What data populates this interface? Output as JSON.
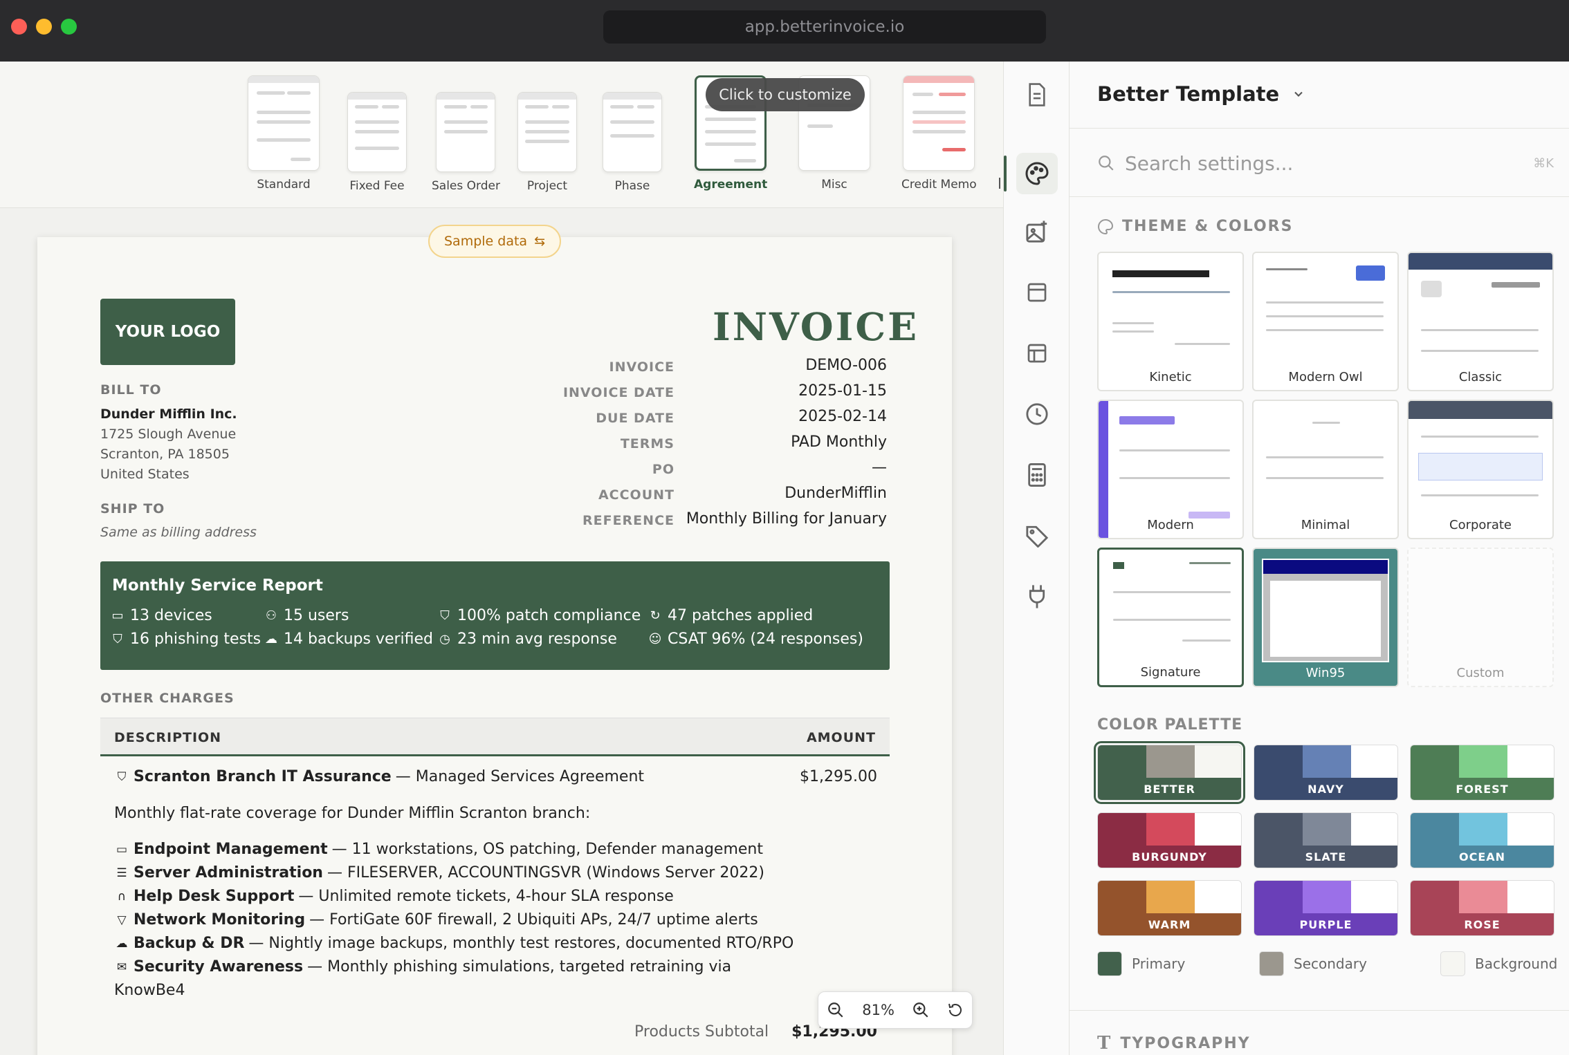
{
  "browser": {
    "url": "app.betterinvoice.io"
  },
  "templates": {
    "tooltip": "Click to customize",
    "items": [
      {
        "label": "Standard"
      },
      {
        "label": "Fixed Fee"
      },
      {
        "label": "Sales Order"
      },
      {
        "label": "Project"
      },
      {
        "label": "Phase"
      },
      {
        "label": "Agreement",
        "selected": true
      },
      {
        "label": "Misc"
      },
      {
        "label": "Credit Memo"
      }
    ]
  },
  "invoice": {
    "sample_data_label": "Sample data",
    "logo_text": "YOUR LOGO",
    "title": "INVOICE",
    "bill_to": {
      "label": "BILL TO",
      "name": "Dunder Mifflin Inc.",
      "address1": "1725 Slough Avenue",
      "address2": "Scranton, PA 18505",
      "country": "United States"
    },
    "ship_to": {
      "label": "SHIP TO",
      "value": "Same as billing address"
    },
    "meta": [
      {
        "key": "INVOICE",
        "value": "DEMO-006"
      },
      {
        "key": "INVOICE DATE",
        "value": "2025-01-15"
      },
      {
        "key": "DUE DATE",
        "value": "2025-02-14"
      },
      {
        "key": "TERMS",
        "value": "PAD Monthly"
      },
      {
        "key": "PO",
        "value": "—"
      },
      {
        "key": "ACCOUNT",
        "value": "DunderMifflin"
      },
      {
        "key": "REFERENCE",
        "value": "Monthly Billing for January"
      }
    ],
    "report": {
      "title": "Monthly Service Report",
      "stats": [
        {
          "icon": "devices-icon",
          "text": "13 devices"
        },
        {
          "icon": "users-icon",
          "text": "15 users"
        },
        {
          "icon": "shield-check-icon",
          "text": "100% patch compliance"
        },
        {
          "icon": "refresh-icon",
          "text": "47 patches applied"
        },
        {
          "icon": "shield-icon",
          "text": "16 phishing tests"
        },
        {
          "icon": "cloud-icon",
          "text": "14 backups verified"
        },
        {
          "icon": "clock-icon",
          "text": "23 min avg response"
        },
        {
          "icon": "smile-icon",
          "text": "CSAT 96% (24 responses)"
        }
      ]
    },
    "other_charges_label": "OTHER CHARGES",
    "table": {
      "col_description": "DESCRIPTION",
      "col_amount": "AMOUNT"
    },
    "line_item": {
      "title": "Scranton Branch IT Assurance",
      "subtitle": " — Managed Services Agreement",
      "amount": "$1,295.00",
      "intro": "Monthly flat-rate coverage for Dunder Mifflin Scranton branch:",
      "features": [
        {
          "icon": "devices-icon",
          "name": "Endpoint Management",
          "desc": " — 11 workstations, OS patching, Defender management"
        },
        {
          "icon": "server-icon",
          "name": "Server Administration",
          "desc": " — FILESERVER, ACCOUNTINGSVR (Windows Server 2022)"
        },
        {
          "icon": "headset-icon",
          "name": "Help Desk Support",
          "desc": " — Unlimited remote tickets, 4-hour SLA response"
        },
        {
          "icon": "wifi-icon",
          "name": "Network Monitoring",
          "desc": " — FortiGate 60F firewall, 2 Ubiquiti APs, 24/7 uptime alerts"
        },
        {
          "icon": "cloud-icon",
          "name": "Backup & DR",
          "desc": " — Nightly image backups, monthly test restores, documented RTO/RPO"
        },
        {
          "icon": "mail-icon",
          "name": "Security Awareness",
          "desc": " — Monthly phishing simulations, targeted retraining via"
        }
      ],
      "features_tail": "KnowBe4"
    },
    "subtotal_label": "Products Subtotal",
    "subtotal_value": "$1,295.00"
  },
  "zoom": {
    "level": "81%"
  },
  "panel": {
    "title": "Better Template",
    "search_placeholder": "Search settings...",
    "search_shortcut": "⌘K",
    "theme_section": "THEME & COLORS",
    "themes": [
      {
        "name": "Kinetic"
      },
      {
        "name": "Modern Owl"
      },
      {
        "name": "Classic"
      },
      {
        "name": "Modern"
      },
      {
        "name": "Minimal"
      },
      {
        "name": "Corporate"
      },
      {
        "name": "Signature",
        "selected": true
      },
      {
        "name": "Win95"
      },
      {
        "name": "Custom"
      }
    ],
    "palette_section": "COLOR PALETTE",
    "palettes": [
      {
        "name": "BETTER",
        "colors": [
          "#42614c",
          "#9b978e",
          "#f6f6f2"
        ],
        "bar": "#42614c",
        "selected": true
      },
      {
        "name": "NAVY",
        "colors": [
          "#3a4b6e",
          "#6581b5",
          "#ffffff"
        ],
        "bar": "#3a4b6e"
      },
      {
        "name": "FOREST",
        "colors": [
          "#4e7d55",
          "#7ecf8a",
          "#ffffff"
        ],
        "bar": "#4e7d55"
      },
      {
        "name": "BURGUNDY",
        "colors": [
          "#8b2c44",
          "#d44a5c",
          "#ffffff"
        ],
        "bar": "#8b2c44"
      },
      {
        "name": "SLATE",
        "colors": [
          "#4b5567",
          "#7f8898",
          "#ffffff"
        ],
        "bar": "#4b5567"
      },
      {
        "name": "OCEAN",
        "colors": [
          "#4b879f",
          "#72c4de",
          "#ffffff"
        ],
        "bar": "#4b879f"
      },
      {
        "name": "WARM",
        "colors": [
          "#94532c",
          "#e8a74c",
          "#ffffff"
        ],
        "bar": "#94532c"
      },
      {
        "name": "PURPLE",
        "colors": [
          "#6a3fb8",
          "#9b70e8",
          "#ffffff"
        ],
        "bar": "#6a3fb8"
      },
      {
        "name": "ROSE",
        "colors": [
          "#a84457",
          "#ea8b96",
          "#ffffff"
        ],
        "bar": "#a84457"
      }
    ],
    "color_legend": [
      {
        "label": "Primary",
        "color": "#42614c"
      },
      {
        "label": "Secondary",
        "color": "#9b978e"
      },
      {
        "label": "Background",
        "color": "#f6f6f2"
      }
    ],
    "typography_section": "TYPOGRAPHY"
  },
  "colors": {
    "accent": "#3e5f48",
    "sample_pill": "#b06a0a"
  }
}
